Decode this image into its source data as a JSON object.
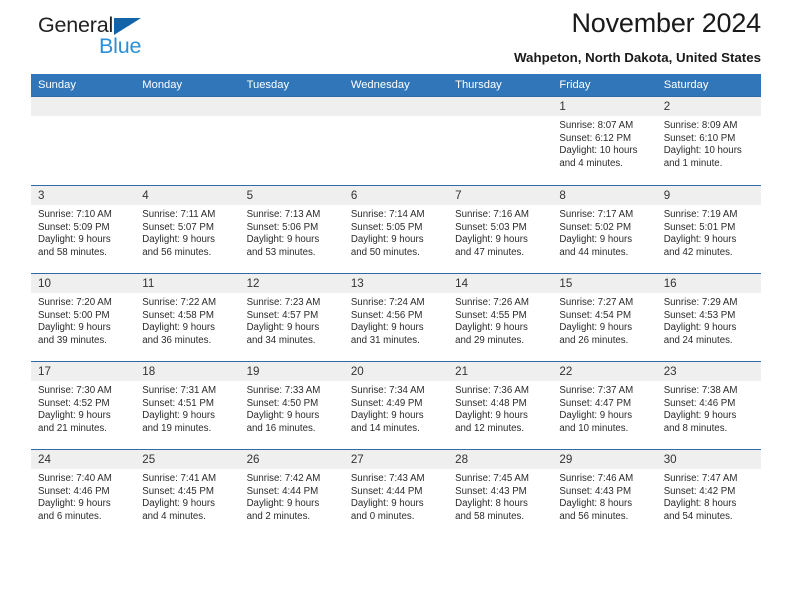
{
  "brand": {
    "name_part1": "General",
    "name_part2": "Blue",
    "accent_color": "#2a8fd6",
    "triangle_color": "#1263a8"
  },
  "header": {
    "title": "November 2024",
    "location": "Wahpeton, North Dakota, United States"
  },
  "calendar": {
    "header_bg": "#3076b9",
    "weekdays": [
      "Sunday",
      "Monday",
      "Tuesday",
      "Wednesday",
      "Thursday",
      "Friday",
      "Saturday"
    ],
    "weeks": [
      [
        {
          "day": "",
          "sunrise": "",
          "sunset": "",
          "daylight_line1": "",
          "daylight_line2": "",
          "empty": true
        },
        {
          "day": "",
          "sunrise": "",
          "sunset": "",
          "daylight_line1": "",
          "daylight_line2": "",
          "empty": true
        },
        {
          "day": "",
          "sunrise": "",
          "sunset": "",
          "daylight_line1": "",
          "daylight_line2": "",
          "empty": true
        },
        {
          "day": "",
          "sunrise": "",
          "sunset": "",
          "daylight_line1": "",
          "daylight_line2": "",
          "empty": true
        },
        {
          "day": "",
          "sunrise": "",
          "sunset": "",
          "daylight_line1": "",
          "daylight_line2": "",
          "empty": true
        },
        {
          "day": "1",
          "sunrise": "Sunrise: 8:07 AM",
          "sunset": "Sunset: 6:12 PM",
          "daylight_line1": "Daylight: 10 hours",
          "daylight_line2": "and 4 minutes.",
          "empty": false
        },
        {
          "day": "2",
          "sunrise": "Sunrise: 8:09 AM",
          "sunset": "Sunset: 6:10 PM",
          "daylight_line1": "Daylight: 10 hours",
          "daylight_line2": "and 1 minute.",
          "empty": false
        }
      ],
      [
        {
          "day": "3",
          "sunrise": "Sunrise: 7:10 AM",
          "sunset": "Sunset: 5:09 PM",
          "daylight_line1": "Daylight: 9 hours",
          "daylight_line2": "and 58 minutes.",
          "empty": false
        },
        {
          "day": "4",
          "sunrise": "Sunrise: 7:11 AM",
          "sunset": "Sunset: 5:07 PM",
          "daylight_line1": "Daylight: 9 hours",
          "daylight_line2": "and 56 minutes.",
          "empty": false
        },
        {
          "day": "5",
          "sunrise": "Sunrise: 7:13 AM",
          "sunset": "Sunset: 5:06 PM",
          "daylight_line1": "Daylight: 9 hours",
          "daylight_line2": "and 53 minutes.",
          "empty": false
        },
        {
          "day": "6",
          "sunrise": "Sunrise: 7:14 AM",
          "sunset": "Sunset: 5:05 PM",
          "daylight_line1": "Daylight: 9 hours",
          "daylight_line2": "and 50 minutes.",
          "empty": false
        },
        {
          "day": "7",
          "sunrise": "Sunrise: 7:16 AM",
          "sunset": "Sunset: 5:03 PM",
          "daylight_line1": "Daylight: 9 hours",
          "daylight_line2": "and 47 minutes.",
          "empty": false
        },
        {
          "day": "8",
          "sunrise": "Sunrise: 7:17 AM",
          "sunset": "Sunset: 5:02 PM",
          "daylight_line1": "Daylight: 9 hours",
          "daylight_line2": "and 44 minutes.",
          "empty": false
        },
        {
          "day": "9",
          "sunrise": "Sunrise: 7:19 AM",
          "sunset": "Sunset: 5:01 PM",
          "daylight_line1": "Daylight: 9 hours",
          "daylight_line2": "and 42 minutes.",
          "empty": false
        }
      ],
      [
        {
          "day": "10",
          "sunrise": "Sunrise: 7:20 AM",
          "sunset": "Sunset: 5:00 PM",
          "daylight_line1": "Daylight: 9 hours",
          "daylight_line2": "and 39 minutes.",
          "empty": false
        },
        {
          "day": "11",
          "sunrise": "Sunrise: 7:22 AM",
          "sunset": "Sunset: 4:58 PM",
          "daylight_line1": "Daylight: 9 hours",
          "daylight_line2": "and 36 minutes.",
          "empty": false
        },
        {
          "day": "12",
          "sunrise": "Sunrise: 7:23 AM",
          "sunset": "Sunset: 4:57 PM",
          "daylight_line1": "Daylight: 9 hours",
          "daylight_line2": "and 34 minutes.",
          "empty": false
        },
        {
          "day": "13",
          "sunrise": "Sunrise: 7:24 AM",
          "sunset": "Sunset: 4:56 PM",
          "daylight_line1": "Daylight: 9 hours",
          "daylight_line2": "and 31 minutes.",
          "empty": false
        },
        {
          "day": "14",
          "sunrise": "Sunrise: 7:26 AM",
          "sunset": "Sunset: 4:55 PM",
          "daylight_line1": "Daylight: 9 hours",
          "daylight_line2": "and 29 minutes.",
          "empty": false
        },
        {
          "day": "15",
          "sunrise": "Sunrise: 7:27 AM",
          "sunset": "Sunset: 4:54 PM",
          "daylight_line1": "Daylight: 9 hours",
          "daylight_line2": "and 26 minutes.",
          "empty": false
        },
        {
          "day": "16",
          "sunrise": "Sunrise: 7:29 AM",
          "sunset": "Sunset: 4:53 PM",
          "daylight_line1": "Daylight: 9 hours",
          "daylight_line2": "and 24 minutes.",
          "empty": false
        }
      ],
      [
        {
          "day": "17",
          "sunrise": "Sunrise: 7:30 AM",
          "sunset": "Sunset: 4:52 PM",
          "daylight_line1": "Daylight: 9 hours",
          "daylight_line2": "and 21 minutes.",
          "empty": false
        },
        {
          "day": "18",
          "sunrise": "Sunrise: 7:31 AM",
          "sunset": "Sunset: 4:51 PM",
          "daylight_line1": "Daylight: 9 hours",
          "daylight_line2": "and 19 minutes.",
          "empty": false
        },
        {
          "day": "19",
          "sunrise": "Sunrise: 7:33 AM",
          "sunset": "Sunset: 4:50 PM",
          "daylight_line1": "Daylight: 9 hours",
          "daylight_line2": "and 16 minutes.",
          "empty": false
        },
        {
          "day": "20",
          "sunrise": "Sunrise: 7:34 AM",
          "sunset": "Sunset: 4:49 PM",
          "daylight_line1": "Daylight: 9 hours",
          "daylight_line2": "and 14 minutes.",
          "empty": false
        },
        {
          "day": "21",
          "sunrise": "Sunrise: 7:36 AM",
          "sunset": "Sunset: 4:48 PM",
          "daylight_line1": "Daylight: 9 hours",
          "daylight_line2": "and 12 minutes.",
          "empty": false
        },
        {
          "day": "22",
          "sunrise": "Sunrise: 7:37 AM",
          "sunset": "Sunset: 4:47 PM",
          "daylight_line1": "Daylight: 9 hours",
          "daylight_line2": "and 10 minutes.",
          "empty": false
        },
        {
          "day": "23",
          "sunrise": "Sunrise: 7:38 AM",
          "sunset": "Sunset: 4:46 PM",
          "daylight_line1": "Daylight: 9 hours",
          "daylight_line2": "and 8 minutes.",
          "empty": false
        }
      ],
      [
        {
          "day": "24",
          "sunrise": "Sunrise: 7:40 AM",
          "sunset": "Sunset: 4:46 PM",
          "daylight_line1": "Daylight: 9 hours",
          "daylight_line2": "and 6 minutes.",
          "empty": false
        },
        {
          "day": "25",
          "sunrise": "Sunrise: 7:41 AM",
          "sunset": "Sunset: 4:45 PM",
          "daylight_line1": "Daylight: 9 hours",
          "daylight_line2": "and 4 minutes.",
          "empty": false
        },
        {
          "day": "26",
          "sunrise": "Sunrise: 7:42 AM",
          "sunset": "Sunset: 4:44 PM",
          "daylight_line1": "Daylight: 9 hours",
          "daylight_line2": "and 2 minutes.",
          "empty": false
        },
        {
          "day": "27",
          "sunrise": "Sunrise: 7:43 AM",
          "sunset": "Sunset: 4:44 PM",
          "daylight_line1": "Daylight: 9 hours",
          "daylight_line2": "and 0 minutes.",
          "empty": false
        },
        {
          "day": "28",
          "sunrise": "Sunrise: 7:45 AM",
          "sunset": "Sunset: 4:43 PM",
          "daylight_line1": "Daylight: 8 hours",
          "daylight_line2": "and 58 minutes.",
          "empty": false
        },
        {
          "day": "29",
          "sunrise": "Sunrise: 7:46 AM",
          "sunset": "Sunset: 4:43 PM",
          "daylight_line1": "Daylight: 8 hours",
          "daylight_line2": "and 56 minutes.",
          "empty": false
        },
        {
          "day": "30",
          "sunrise": "Sunrise: 7:47 AM",
          "sunset": "Sunset: 4:42 PM",
          "daylight_line1": "Daylight: 8 hours",
          "daylight_line2": "and 54 minutes.",
          "empty": false
        }
      ]
    ]
  }
}
